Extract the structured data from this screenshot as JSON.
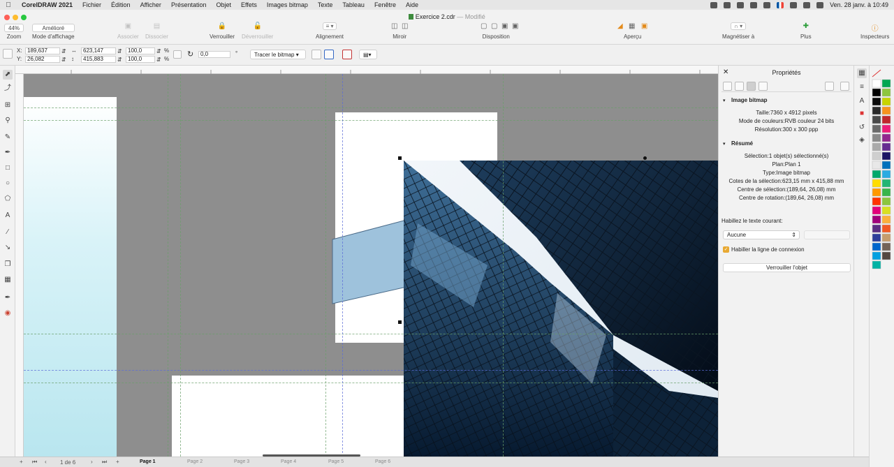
{
  "menu_bar": {
    "app_name": "CorelDRAW 2021",
    "items": [
      "Fichier",
      "Édition",
      "Afficher",
      "Présentation",
      "Objet",
      "Effets",
      "Images bitmap",
      "Texte",
      "Tableau",
      "Fenêtre",
      "Aide"
    ],
    "clock": "Ven. 28 janv. à 10:49"
  },
  "window": {
    "document_title": "Exercice 2.cdr",
    "modified_label": "Modifié"
  },
  "toolbar": {
    "zoom_value": "44%",
    "zoom_label": "Zoom",
    "view_mode_value": "Amélioré",
    "view_mode_label": "Mode d'affichage",
    "associer": "Associer",
    "dissocier": "Dissocier",
    "verrouiller": "Verrouiller",
    "deverrouiller": "Déverrouiller",
    "alignement": "Alignement",
    "miroir": "Miroir",
    "disposition": "Disposition",
    "apercu": "Aperçu",
    "magnetiser": "Magnétiser à",
    "plus": "Plus",
    "inspecteurs": "Inspecteurs"
  },
  "property_bar": {
    "x_label": "X:",
    "x_value": "189,637",
    "y_label": "Y:",
    "y_value": "26,082",
    "width_value": "623,147",
    "height_value": "415,883",
    "scale_x": "100,0",
    "scale_y": "100,0",
    "percent": "%",
    "rotation": "0,0",
    "degree": "°",
    "trace_button": "Tracer le bitmap"
  },
  "properties_panel": {
    "title": "Propriétés",
    "section_bitmap": "Image bitmap",
    "taille": "Taille:7360 x 4912 pixels",
    "mode_couleurs": "Mode de couleurs:RVB couleur 24 bits",
    "resolution": "Résolution:300 x 300 ppp",
    "section_resume": "Résumé",
    "selection": "Sélection:1 objet(s) sélectionné(s)",
    "plan": "Plan:Plan 1",
    "type": "Type:Image bitmap",
    "cotes": "Cotes de la sélection:623,15 mm x 415,88 mm",
    "centre_selection": "Centre de sélection:(189,64, 26,08) mm",
    "centre_rotation": "Centre de rotation:(189,64, 26,08) mm",
    "text_wrap_label": "Habillez le texte courant:",
    "text_wrap_value": "Aucune",
    "checkbox_label": "Habiller la ligne de connexion",
    "lock_button": "Verrouiller l'objet"
  },
  "status_bar": {
    "page_counter": "1 de 6",
    "pages": [
      "Page 1",
      "Page 2",
      "Page 3",
      "Page 4",
      "Page 5",
      "Page 6"
    ]
  },
  "colors": {
    "canvas_bg": "#8e8e8e",
    "light_cyan": "#cdeef5",
    "shape_blue": "#9ec2dc",
    "accent_orange": "#e38a1a"
  },
  "palette_colors": [
    "#ffffff",
    "#000000",
    "#0a0a0a",
    "#2a2a2a",
    "#4a4a4a",
    "#6a6a6a",
    "#8a8a8a",
    "#aaaaaa",
    "#cfcfcf",
    "#e8e8e8",
    "#00a86b",
    "#ffdd00",
    "#ff9900",
    "#ff3300",
    "#e2007a",
    "#a0007a",
    "#5a2d82",
    "#2d3e9a",
    "#0066cc",
    "#00a0e0",
    "#00b3a4",
    "#00a651",
    "#8dc63f",
    "#c8d400",
    "#f7931e",
    "#c1272d",
    "#ed1e79",
    "#93278f",
    "#662d91",
    "#1b1464",
    "#0071bc",
    "#29abe2",
    "#22b573",
    "#39b54a",
    "#8cc63f",
    "#d9e021",
    "#fbb03b",
    "#f15a24",
    "#c69c6d",
    "#736357",
    "#534741"
  ]
}
